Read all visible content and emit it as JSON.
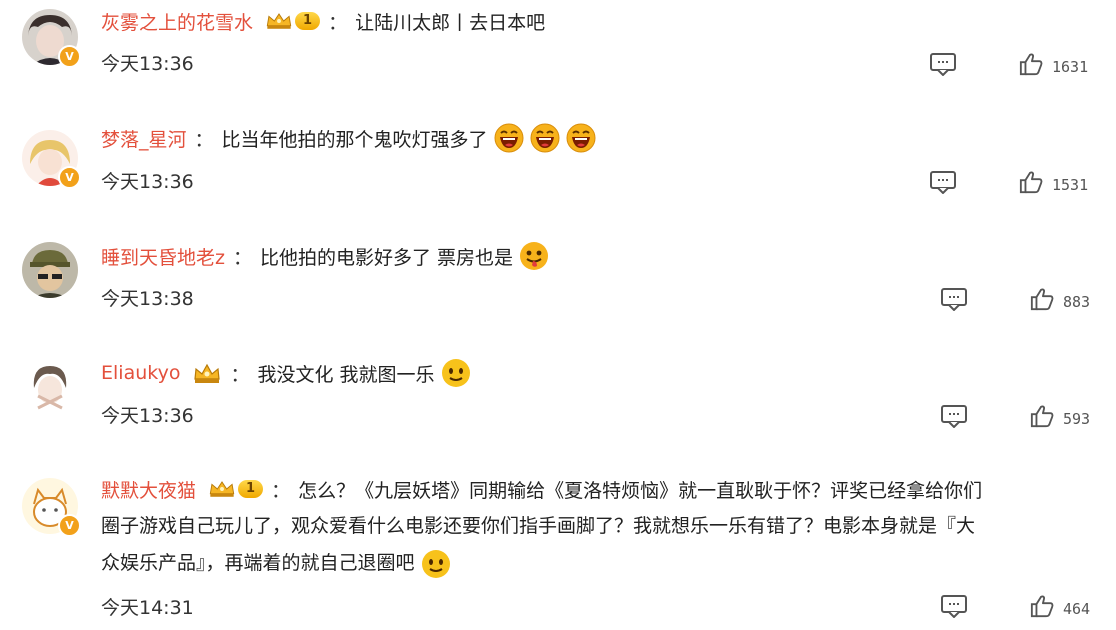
{
  "comments": [
    {
      "username": "灰雾之上的花雪水",
      "level": "1",
      "text": "让陆川太郎丨去日本吧",
      "time": "今天13:36",
      "likes": "1631"
    },
    {
      "username": "梦落_星河",
      "text": "比当年他拍的那个鬼吹灯强多了",
      "time": "今天13:36",
      "likes": "1531"
    },
    {
      "username": "睡到天昏地老z",
      "text": "比他拍的电影好多了 票房也是",
      "time": "今天13:38",
      "likes": "883"
    },
    {
      "username": "Eliaukyo",
      "text": "我没文化 我就图一乐",
      "time": "今天13:36",
      "likes": "593"
    },
    {
      "username": "默默大夜猫",
      "level": "1",
      "text_line1": "怎么？《九层妖塔》同期输给《夏洛特烦恼》就一直耿耿于怀？评奖已经拿给你们",
      "text_line2": "圈子游戏自己玩儿了，观众爱看什么电影还要你们指手画脚了？我就想乐一乐有错了？电影本身就是『大",
      "text_line3": "众娱乐产品』，再端着的就自己退圈吧",
      "time": "今天14:31",
      "likes": "464"
    }
  ],
  "colors": {
    "username": "#e3503c",
    "badge": "#f2a11a",
    "emoji": "#f7b21b"
  }
}
